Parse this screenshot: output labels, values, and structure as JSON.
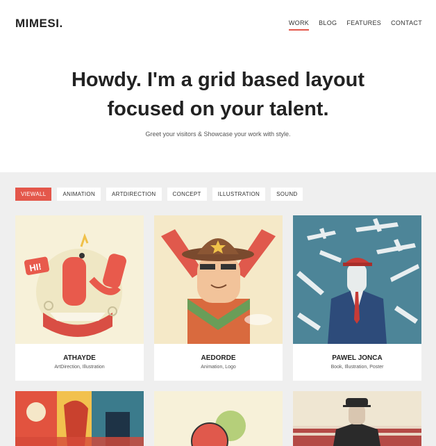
{
  "header": {
    "logo": "MIMESI.",
    "nav": [
      {
        "label": "WORK",
        "active": true
      },
      {
        "label": "BLOG",
        "active": false
      },
      {
        "label": "FEATURES",
        "active": false
      },
      {
        "label": "CONTACT",
        "active": false
      }
    ]
  },
  "hero": {
    "title_line1": "Howdy. I'm a grid based layout",
    "title_line2": "focused on your talent.",
    "subtitle": "Greet your visitors & Showcase your work with style."
  },
  "filters": [
    "VIEWALL",
    "ANIMATION",
    "ARTDIRECTION",
    "CONCEPT",
    "ILLUSTRATION",
    "SOUND"
  ],
  "active_filter": "VIEWALL",
  "projects": [
    {
      "title": "ATHAYDE",
      "tags": "ArtDirection, Illustration"
    },
    {
      "title": "AEDORDE",
      "tags": "Animation, Logo"
    },
    {
      "title": "PAWEL JONCA",
      "tags": "Book, Illustration, Poster"
    }
  ],
  "colors": {
    "accent": "#e4574b",
    "background": "#efefef"
  }
}
